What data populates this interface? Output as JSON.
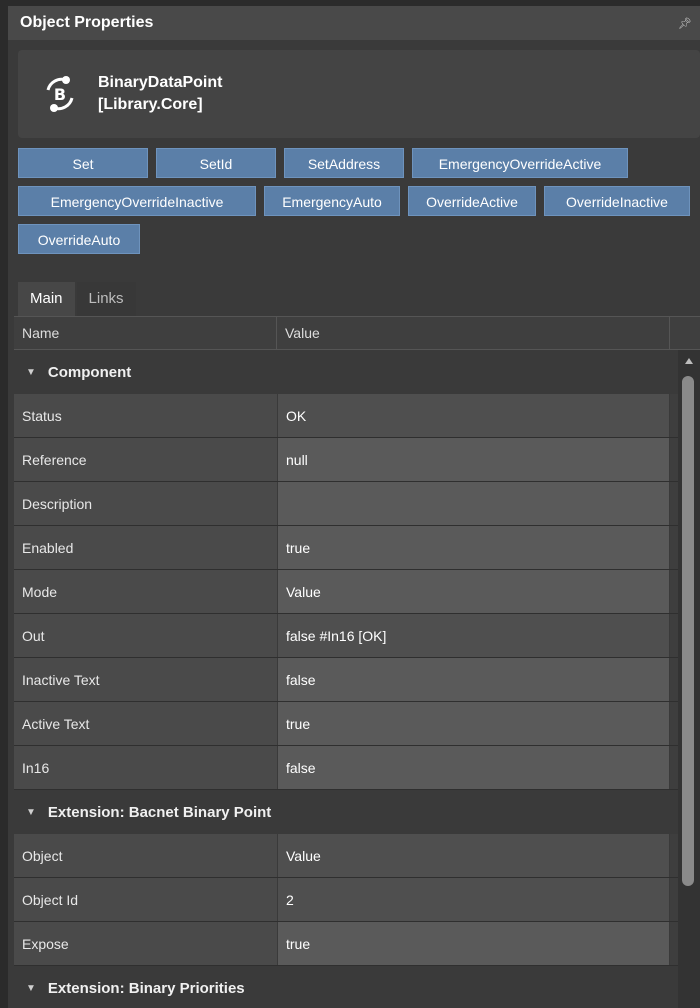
{
  "window": {
    "title": "Object Properties"
  },
  "object": {
    "icon": "binary-datapoint-icon",
    "name": "BinaryDataPoint",
    "library": "[Library.Core]"
  },
  "actions": [
    [
      "Set",
      "SetId",
      "SetAddress",
      "EmergencyOverrideActive"
    ],
    [
      "EmergencyOverrideInactive",
      "EmergencyAuto",
      "OverrideActive",
      "OverrideInactive"
    ],
    [
      "OverrideAuto"
    ]
  ],
  "tabs": [
    "Main",
    "Links"
  ],
  "grid": {
    "columns": [
      "Name",
      "Value"
    ],
    "sections": [
      {
        "title": "Component",
        "rows": [
          {
            "name": "Status",
            "value": "OK"
          },
          {
            "name": "Reference",
            "value": "null"
          },
          {
            "name": "Description",
            "value": ""
          },
          {
            "name": "Enabled",
            "value": "true"
          },
          {
            "name": "Mode",
            "value": "Value"
          },
          {
            "name": "Out",
            "value": "false #In16 [OK]"
          },
          {
            "name": "Inactive Text",
            "value": "false"
          },
          {
            "name": "Active Text",
            "value": "true"
          },
          {
            "name": "In16",
            "value": "false"
          }
        ]
      },
      {
        "title": "Extension: Bacnet Binary Point",
        "rows": [
          {
            "name": "Object",
            "value": "Value"
          },
          {
            "name": "Object Id",
            "value": "2"
          },
          {
            "name": "Expose",
            "value": "true"
          }
        ]
      },
      {
        "title": "Extension: Binary Priorities",
        "rows": []
      }
    ]
  }
}
